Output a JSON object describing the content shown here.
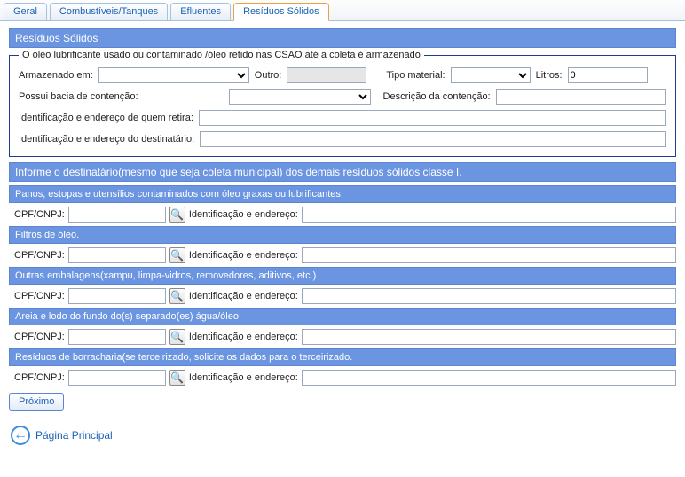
{
  "tabs": {
    "geral": "Geral",
    "combustiveis": "Combustíveis/Tanques",
    "efluentes": "Efluentes",
    "residuos": "Resíduos Sólidos"
  },
  "section_residuos_title": "Resíduos Sólidos",
  "oil_group": {
    "legend": "O óleo lubrificante usado ou contaminado /óleo retido nas CSAO até a coleta é armazenado",
    "armazenado_em_label": "Armazenado em:",
    "armazenado_em_value": "",
    "outro_label": "Outro:",
    "outro_value": "",
    "tipo_material_label": "Tipo material:",
    "tipo_material_value": "",
    "litros_label": "Litros:",
    "litros_value": "0",
    "possui_bacia_label": "Possui bacia de contenção:",
    "possui_bacia_value": "",
    "descricao_contencao_label": "Descrição da contenção:",
    "descricao_contencao_value": "",
    "ident_retira_label": "Identificação e endereço de quem retira:",
    "ident_retira_value": "",
    "ident_dest_label": "Identificação e endereço do destinatário:",
    "ident_dest_value": ""
  },
  "informe_header": "Informe o destinatário(mesmo que seja coleta municipal) dos demais resíduos sólidos classe I.",
  "common": {
    "cpf_label": "CPF/CNPJ:",
    "ident_label": "Identificação e endereço:",
    "search_icon_glyph": "🔍"
  },
  "groups": {
    "panos": {
      "header": "Panos, estopas e utensílios contaminados com óleo graxas ou lubrificantes:",
      "cpf": "",
      "ident": ""
    },
    "filtros": {
      "header": "Filtros de óleo.",
      "cpf": "",
      "ident": ""
    },
    "outras": {
      "header": "Outras embalagens(xampu, limpa-vidros, removedores, aditivos, etc.)",
      "cpf": "",
      "ident": ""
    },
    "areia": {
      "header": "Areia e lodo do fundo do(s) separado(es) água/óleo.",
      "cpf": "",
      "ident": ""
    },
    "borracharia": {
      "header": "Resíduos de borracharia(se terceirizado, solicite os dados para o terceirizado.",
      "cpf": "",
      "ident": ""
    }
  },
  "buttons": {
    "proximo": "Próximo"
  },
  "footer": {
    "back_glyph": "←",
    "home_link": "Página Principal"
  }
}
